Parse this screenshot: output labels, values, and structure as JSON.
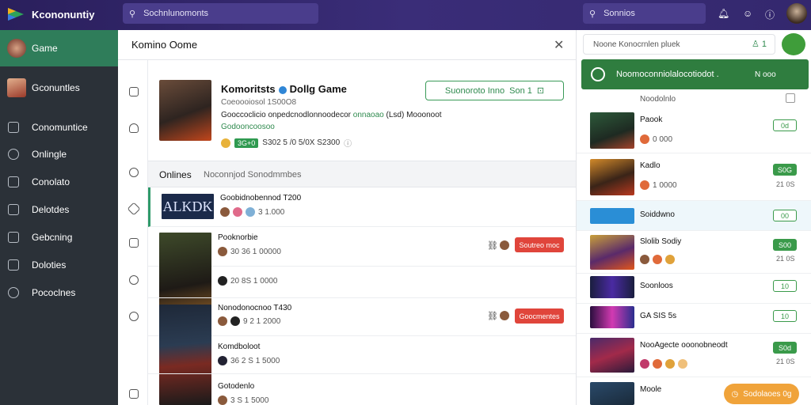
{
  "app": {
    "name": "Kcononuntiy"
  },
  "topbar": {
    "search_placeholder": "Sochnlunomonts",
    "search2_placeholder": "Sonnios"
  },
  "sidebar": {
    "game_label": "Game",
    "profile_label": "Gconuntles",
    "items": [
      {
        "label": "Conomuntice",
        "icon": "users-icon"
      },
      {
        "label": "Onlingle",
        "icon": "chat-icon"
      },
      {
        "label": "Conolato",
        "icon": "lock-icon"
      },
      {
        "label": "Delotdes",
        "icon": "list-icon"
      },
      {
        "label": "Gebcning",
        "icon": "grid-icon"
      },
      {
        "label": "Doloties",
        "icon": "box-icon"
      },
      {
        "label": "Pococlnes",
        "icon": "settings-icon"
      }
    ]
  },
  "main": {
    "title": "Komino Oome",
    "hero": {
      "title": "Komoritsts",
      "title2": "Dollg Game",
      "subtitle": "Coeoooiosol 1S00O8",
      "desc_pre": "Gooccoclicio onpedcnodlonnoodecor",
      "desc_green": "onnaoao",
      "desc_post": "(Lsd) Mooonoot",
      "green": "Godooncoosoo",
      "pill": "3G+0",
      "stats": "S302 5 /0 5/0X S2300",
      "subscribe": "Suonoroto Inno",
      "subscribe2": "Son 1"
    },
    "section": {
      "title": "Onlines",
      "subtitle": "Noconnjod Sonodmmbes"
    },
    "rows": [
      {
        "title": "Goobidnobennod T200",
        "meta": "3 1.000",
        "thumb_text": "ALKDK"
      },
      {
        "title": "Pooknorbie",
        "meta": "30 36 1 00000",
        "button": "Soutreo moc"
      },
      {
        "title": "",
        "meta": "20 8S 1 0000"
      },
      {
        "title": "Nonodonocnoo T430",
        "meta": "9 2 1 2000",
        "button": "Goocmentes"
      },
      {
        "title": "Komdboloot",
        "meta": "36 2 S 1 5000"
      },
      {
        "title": "Gotodenlo",
        "meta": "3 S 1 5000"
      }
    ]
  },
  "right": {
    "search_placeholder": "Noone Konocrnlen pluek",
    "search_count": "1",
    "toast": {
      "text": "Noomoconniolalocotiodot .",
      "action": "N ooo"
    },
    "header": "Noodolnlo",
    "items": [
      {
        "title": "Paook",
        "sub": "0 000",
        "badge": "0d",
        "num": ""
      },
      {
        "title": "Kadlo",
        "sub": "1 0000",
        "badge": "S0G",
        "num": "21 0S"
      },
      {
        "title": "Soiddwno",
        "sub": "",
        "badge": "00",
        "num": ""
      },
      {
        "title": "Slolib Sodiy",
        "sub": "",
        "badge": "S00",
        "num": "21 0S"
      },
      {
        "title": "Soonloos",
        "sub": "",
        "badge": "10",
        "num": ""
      },
      {
        "title": "GA SIS 5s",
        "sub": "",
        "badge": "10",
        "num": ""
      },
      {
        "title": "NooAgecte ooonobneodt",
        "sub": "",
        "badge": "S0d",
        "num": "21 0S"
      },
      {
        "title": "Moole",
        "sub": "",
        "badge": "",
        "num": ""
      }
    ],
    "orange_button": "Sodolaoes 0g"
  }
}
